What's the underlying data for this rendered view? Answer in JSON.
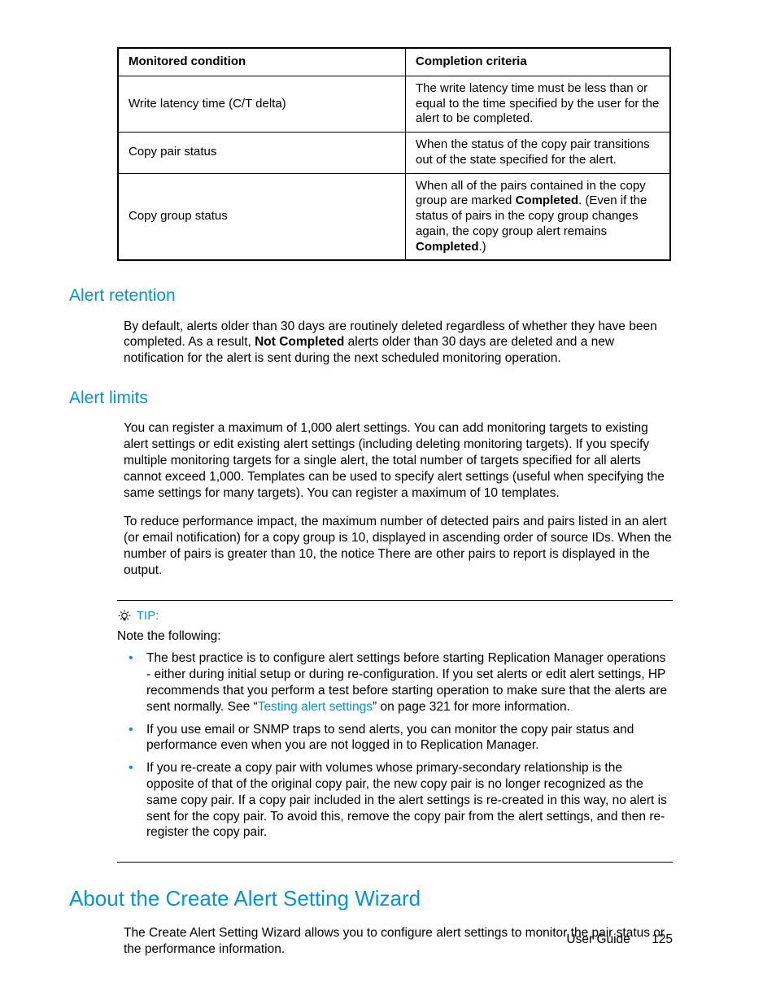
{
  "table": {
    "headers": [
      "Monitored condition",
      "Completion criteria"
    ],
    "rows": [
      {
        "cond": "Write latency time (C/T delta)",
        "crit": "The write latency time must be less than or equal to the time specified by the user for the alert to be completed."
      },
      {
        "cond": "Copy pair status",
        "crit": "When the status of the copy pair transitions out of the state specified for the alert."
      },
      {
        "cond": "Copy group status",
        "crit_pre": "When all of the pairs contained in the copy group are marked ",
        "crit_b1": "Completed",
        "crit_mid": ". (Even if the status of pairs in the copy group changes again, the copy group alert remains ",
        "crit_b2": "Completed",
        "crit_post": ".)"
      }
    ]
  },
  "alert_retention": {
    "title": "Alert retention",
    "p_pre": "By default, alerts older than 30 days are routinely deleted regardless of whether they have been completed. As a result, ",
    "p_bold": "Not Completed",
    "p_post": " alerts older than 30 days are deleted and a new notification for the alert is sent during the next scheduled monitoring operation."
  },
  "alert_limits": {
    "title": "Alert limits",
    "p1": "You can register a maximum of 1,000 alert settings. You can add monitoring targets to existing alert settings or edit existing alert settings (including deleting monitoring targets). If you specify multiple monitoring targets for a single alert, the total number of targets specified for all alerts cannot exceed 1,000. Templates can be used to specify alert settings (useful when specifying the same settings for many targets). You can register a maximum of 10 templates.",
    "p2": "To reduce performance impact, the maximum number of detected pairs and pairs listed in an alert (or email notification) for a copy group is 10, displayed in ascending order of source IDs. When the number of pairs is greater than 10, the notice There are other pairs to report is displayed in the output."
  },
  "tip": {
    "label": "TIP:",
    "note": "Note the following:",
    "items": {
      "i1_pre": "The best practice is to configure alert settings before starting Replication Manager operations - either during initial setup or during re-configuration. If you set alerts or edit alert settings, HP recommends that you perform a test before starting operation to make sure that the alerts are sent normally. See “",
      "i1_link": "Testing alert settings",
      "i1_post": "” on page 321 for more information.",
      "i2": "If you use email or SNMP traps to send alerts, you can monitor the copy pair status and performance even when you are not logged in to Replication Manager.",
      "i3": "If you re-create a copy pair with volumes whose primary-secondary relationship is the opposite of that of the original copy pair, the new copy pair is no longer recognized as the same copy pair. If a copy pair included in the alert settings is re-created in this way, no alert is sent for the copy pair. To avoid this, remove the copy pair from the alert settings, and then re-register the copy pair."
    }
  },
  "wizard": {
    "title": "About the Create Alert Setting Wizard",
    "p": "The Create Alert Setting Wizard allows you to configure alert settings to monitor the pair status or the performance information."
  },
  "footer": {
    "doc": "User Guide",
    "page": "125"
  }
}
